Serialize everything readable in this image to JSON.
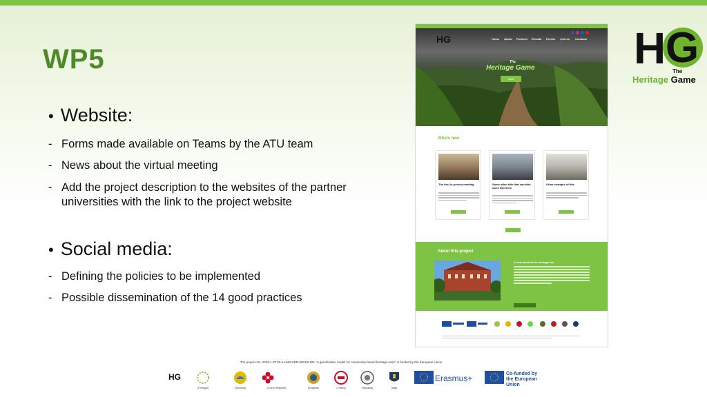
{
  "slide": {
    "title": "WP5",
    "sections": [
      {
        "heading": "Website:",
        "items": [
          "Forms made available on Teams by the ATU team",
          "News about the virtual meeting",
          "Add the project description to the websites of the partner universities with the link to the project website"
        ]
      },
      {
        "heading": "Social media:",
        "items": [
          "Defining the policies to be implemented",
          "Possible dissemination of the 14 good practices"
        ]
      }
    ],
    "bullet_glyph": "•",
    "dash_glyph": "-"
  },
  "logo": {
    "letters_h": "H",
    "letters_g": "G",
    "the": "The",
    "word1": "Heritage",
    "word2": "Game"
  },
  "website_mockup": {
    "hero_logo": "HG",
    "nav": [
      "Home",
      "About",
      "Partners",
      "Results",
      "Events",
      "Join us",
      "Contacts"
    ],
    "hero_title": "Heritage Game",
    "hero_title_small": "The",
    "hero_button": "Start",
    "whats_new": "Whats new",
    "cards": [
      {
        "title": "The first in-person meeting"
      },
      {
        "title": "Some other title that can take up to two lines"
      },
      {
        "title": "Other example of title"
      }
    ],
    "about_title": "About this project",
    "about_heading": "A new mindset for heritage fun"
  },
  "footer": {
    "credit": "The project No. 2023-1-PT01-KA220-HED-000154281 \"A gamification model for community-based heritage work\" is funded by the European Union",
    "partner_labels": [
      "(Portugal)",
      "(Slovenia)",
      "(Czech Republic)",
      "(Bulgaria)",
      "(Turkey)",
      "(Slovakia)",
      "(Italy)"
    ],
    "erasmus": "Erasmus+",
    "cofunded_line1": "Co-funded by",
    "cofunded_line2": "the European Union"
  },
  "colors": {
    "accent_green": "#7ec344",
    "title_green": "#4e8a2b",
    "eu_blue": "#1f4fa3"
  }
}
